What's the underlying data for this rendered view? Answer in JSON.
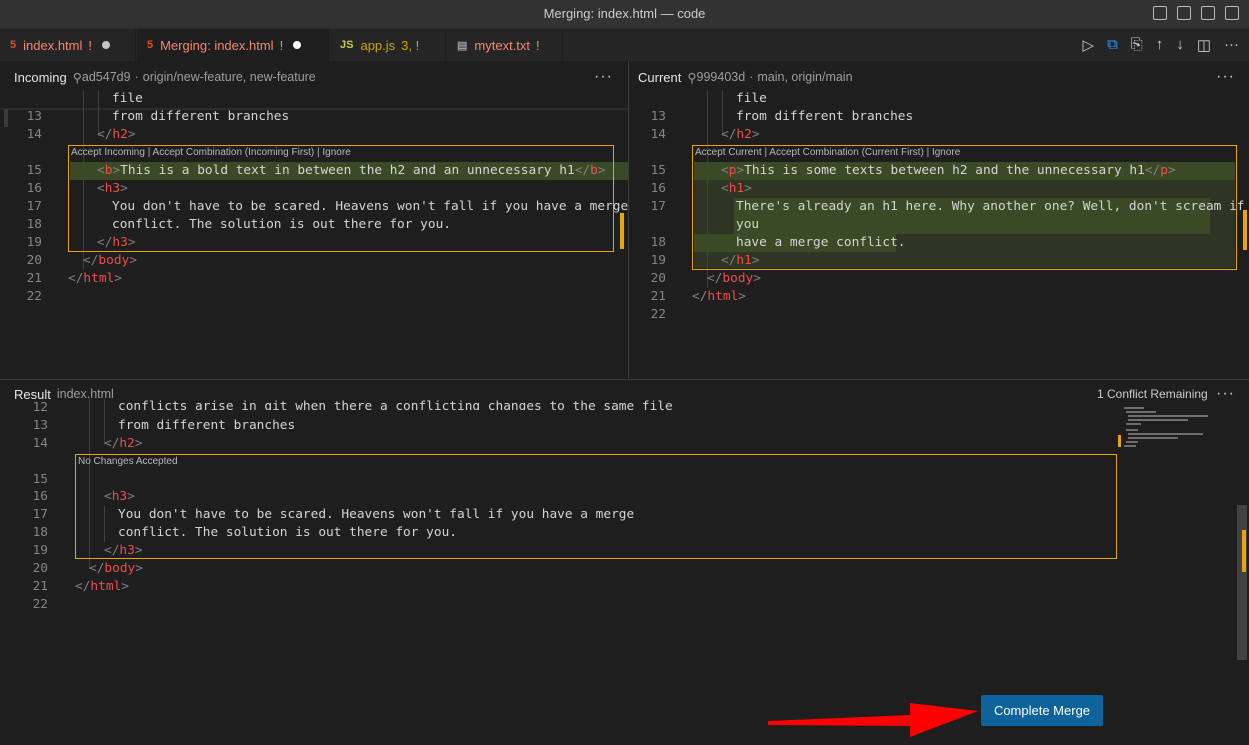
{
  "window": {
    "title": "Merging: index.html — code"
  },
  "tabs": [
    {
      "icon": "html-icon",
      "label": "index.html",
      "status": "!",
      "dirty": true
    },
    {
      "icon": "html-icon",
      "label": "Merging: index.html",
      "status": "!",
      "dirty": true
    },
    {
      "icon": "js-icon",
      "icon_text": "JS",
      "label": "app.js",
      "status": "3, !"
    },
    {
      "icon": "file-icon",
      "label": "mytext.txt",
      "status": "!"
    }
  ],
  "incoming": {
    "label": "Incoming",
    "commit": "ad547d9",
    "branches": "origin/new-feature, new-feature",
    "codelens": "Accept Incoming | Accept Combination (Incoming First) | Ignore",
    "line_numbers": [
      "13",
      "14",
      "15",
      "16",
      "17",
      "18",
      "19",
      "20",
      "21",
      "22"
    ],
    "lines": {
      "l_file": "file",
      "l13": "from different branches",
      "l15_text": "This is a bold text in between the h2 and an unnecessary h1",
      "l17": "You don't have to be scared. Heavens won't fall if you have a merge",
      "l18": "conflict. The solution is out there for you."
    }
  },
  "current": {
    "label": "Current",
    "commit": "999403d",
    "branches": "main, origin/main",
    "codelens": "Accept Current | Accept Combination (Current First) | Ignore",
    "line_numbers": [
      "13",
      "14",
      "15",
      "16",
      "17",
      "18",
      "19",
      "20",
      "21",
      "22"
    ],
    "lines": {
      "l_file": "file",
      "l13": "from different branches",
      "l15_text": "This is some texts between h2 and the unnecessary h1",
      "l17a": "There's already an h1 here. Why another one? Well, don't scream if",
      "l17b": "you",
      "l18": "have a merge conflict."
    }
  },
  "result": {
    "label": "Result",
    "filename": "index.html",
    "conflicts": "1 Conflict Remaining",
    "codelens": "No Changes Accepted",
    "line_numbers": [
      "12",
      "13",
      "14",
      "15",
      "16",
      "17",
      "18",
      "19",
      "20",
      "21",
      "22"
    ],
    "lines": {
      "l12": "conflicts arise in git when there a conflicting changes to the same file",
      "l13": "from different branches",
      "l17": "You don't have to be scared. Heavens won't fall if you have a merge",
      "l18": "conflict. The solution is out there for you."
    }
  },
  "tags": {
    "h2": "h2",
    "h3": "h3",
    "h1": "h1",
    "b": "b",
    "p": "p",
    "body": "body",
    "html": "html"
  },
  "complete_merge": {
    "label": "Complete Merge"
  },
  "colors": {
    "accent": "#0e639c",
    "conflict": "#e6a40f",
    "tag": "#f14c4c",
    "arrow": "#ff0000"
  }
}
